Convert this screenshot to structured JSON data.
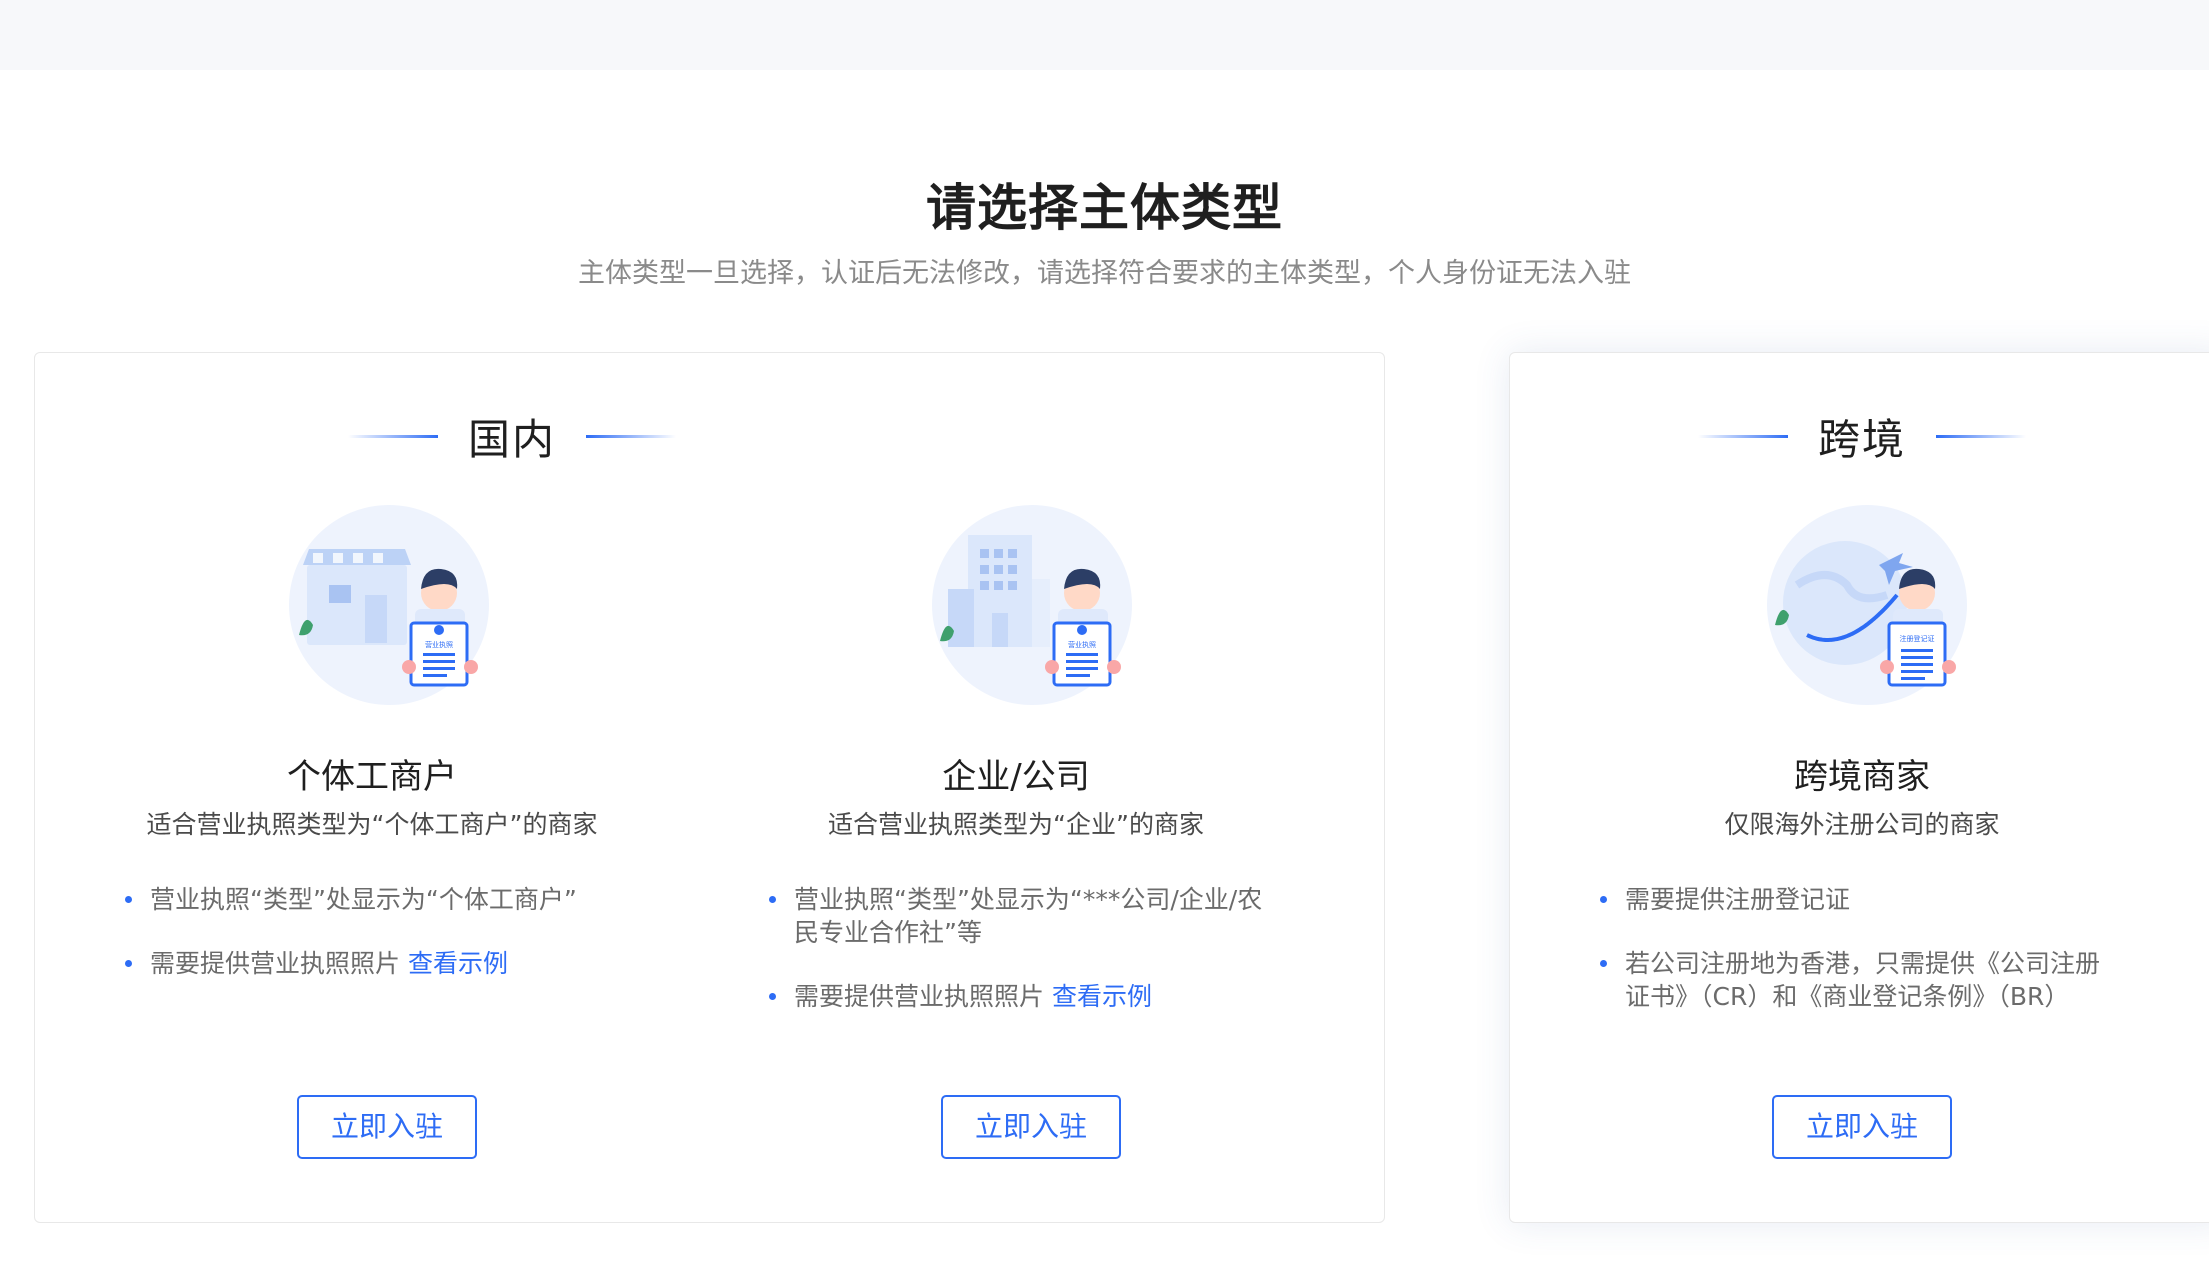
{
  "page": {
    "title": "请选择主体类型",
    "subtitle": "主体类型一旦选择，认证后无法修改，请选择符合要求的主体类型，个人身份证无法入驻"
  },
  "domestic": {
    "section_label": "国内",
    "options": [
      {
        "title": "个体工商户",
        "desc": "适合营业执照类型为“个体工商户”的商家",
        "bullets": [
          "营业执照“类型”处显示为“个体工商户”",
          "需要提供营业执照照片 "
        ],
        "example_link": "查看示例",
        "button": "立即入驻",
        "illustration": "storefront-with-person-holding-license",
        "certificate_text": "营业执照"
      },
      {
        "title": "企业/公司",
        "desc": "适合营业执照类型为“企业”的商家",
        "bullets": [
          "营业执照“类型”处显示为“***公司/企业/农民专业合作社”等",
          "需要提供营业执照照片 "
        ],
        "example_link": "查看示例",
        "button": "立即入驻",
        "illustration": "office-building-with-person-holding-license",
        "certificate_text": "营业执照"
      }
    ]
  },
  "crossborder": {
    "section_label": "跨境",
    "option": {
      "title": "跨境商家",
      "desc": "仅限海外注册公司的商家",
      "bullets": [
        "需要提供注册登记证",
        "若公司注册地为香港，只需提供《公司注册证书》（CR）和《商业登记条例》（BR）"
      ],
      "button": "立即入驻",
      "illustration": "globe-airplane-with-person-holding-registration",
      "certificate_text": "注册登记证"
    }
  },
  "colors": {
    "accent": "#2d6cf5",
    "illustration_bg": "#eef3fd"
  }
}
